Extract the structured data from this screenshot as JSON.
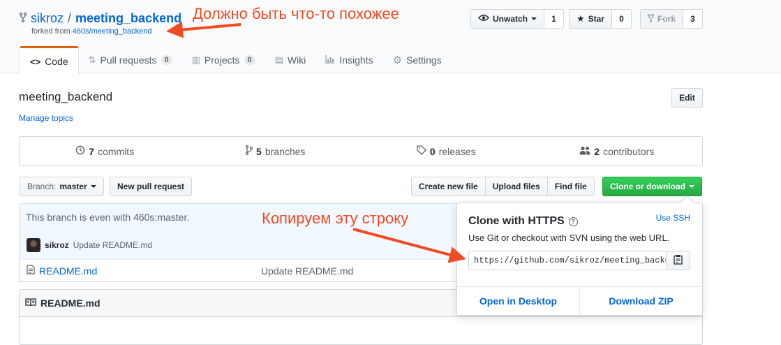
{
  "repo": {
    "owner": "sikroz",
    "separator": "/",
    "name": "meeting_backend",
    "fork_prefix": "forked from",
    "fork_source": "460s/meeting_backend"
  },
  "actions": {
    "unwatch_label": "Unwatch",
    "watch_count": "1",
    "star_label": "Star",
    "star_count": "0",
    "fork_label": "Fork",
    "fork_count": "3"
  },
  "tabs": [
    {
      "label": "Code",
      "icon": "code-icon"
    },
    {
      "label": "Pull requests",
      "icon": "pull-request-icon",
      "badge": "0"
    },
    {
      "label": "Projects",
      "icon": "project-icon",
      "badge": "0"
    },
    {
      "label": "Wiki",
      "icon": "book-icon"
    },
    {
      "label": "Insights",
      "icon": "graph-icon"
    },
    {
      "label": "Settings",
      "icon": "gear-icon"
    }
  ],
  "about": {
    "description": "meeting_backend",
    "manage_topics": "Manage topics",
    "edit_label": "Edit"
  },
  "summary": {
    "commits_count": "7",
    "commits_label": "commits",
    "branches_count": "5",
    "branches_label": "branches",
    "releases_count": "0",
    "releases_label": "releases",
    "contributors_count": "2",
    "contributors_label": "contributors"
  },
  "toolbar": {
    "branch_prefix": "Branch:",
    "branch_name": "master",
    "new_pr": "New pull request",
    "create_file": "Create new file",
    "upload_files": "Upload files",
    "find_file": "Find file",
    "clone_download": "Clone or download"
  },
  "files": {
    "branch_status": "This branch is even with 460s:master.",
    "commit_author": "sikroz",
    "commit_message": "Update README.md",
    "rows": [
      {
        "name": "README.md",
        "message": "Update README.md"
      }
    ]
  },
  "readme": {
    "title": "README.md"
  },
  "clone": {
    "title": "Clone with HTTPS",
    "use_ssh": "Use SSH",
    "description": "Use Git or checkout with SVN using the web URL.",
    "url": "https://github.com/sikroz/meeting_backend.git",
    "open_desktop": "Open in Desktop",
    "download_zip": "Download ZIP"
  },
  "annotations": {
    "top": "Должно быть что-то похожее",
    "middle": "Копируем эту строку",
    "color": "#f04b23"
  },
  "colors": {
    "link": "#0366d6",
    "tab_accent": "#e36209",
    "clone_green": "#28a745"
  }
}
